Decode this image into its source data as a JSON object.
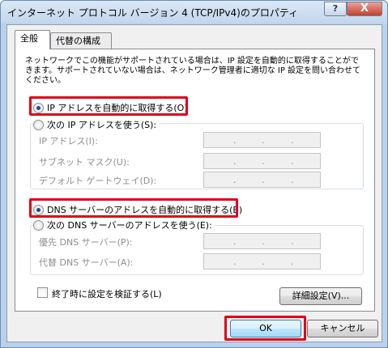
{
  "window": {
    "title": "インターネット プロトコル バージョン 4 (TCP/IPv4)のプロパティ",
    "help_label": "?",
    "close_label": "X"
  },
  "tabs": [
    {
      "label": "全般",
      "selected": true
    },
    {
      "label": "代替の構成",
      "selected": false
    }
  ],
  "description": "ネットワークでこの機能がサポートされている場合は、IP 設定を自動的に取得することができます。サポートされていない場合は、ネットワーク管理者に適切な IP 設定を問い合わせてください。",
  "ip": {
    "auto_label": "IP アドレスを自動的に取得する(O)",
    "auto_checked": true,
    "manual_label": "次の IP アドレスを使う(S):",
    "fields": [
      {
        "label": "IP アドレス(I):",
        "value": ". . ."
      },
      {
        "label": "サブネット マスク(U):",
        "value": ". . ."
      },
      {
        "label": "デフォルト ゲートウェイ(D):",
        "value": ". . ."
      }
    ]
  },
  "dns": {
    "auto_label": "DNS サーバーのアドレスを自動的に取得する(B)",
    "auto_checked": true,
    "manual_label": "次の DNS サーバーのアドレスを使う(E):",
    "fields": [
      {
        "label": "優先 DNS サーバー(P):",
        "value": ". . ."
      },
      {
        "label": "代替 DNS サーバー(A):",
        "value": ". . ."
      }
    ]
  },
  "validate_on_exit_label": "終了時に設定を検証する(L)",
  "advanced_label": "詳細設定(V)...",
  "ok_label": "OK",
  "cancel_label": "キャンセル",
  "colors": {
    "highlight_border": "#e0001b",
    "ok_border": "#3c7fb1"
  }
}
